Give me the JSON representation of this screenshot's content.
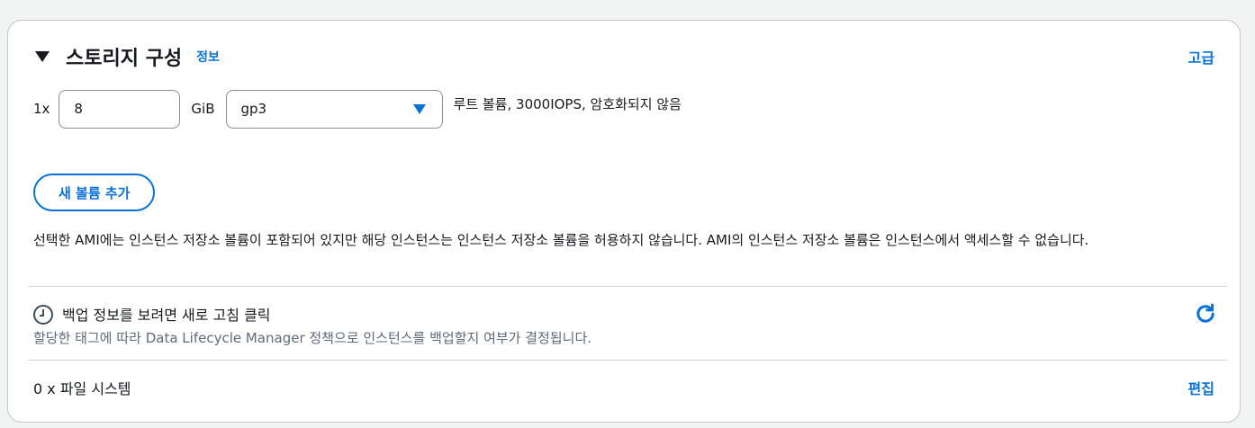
{
  "section": {
    "title": "스토리지 구성",
    "info_link": "정보",
    "advanced_link": "고급"
  },
  "volume": {
    "quantity": "1x",
    "size_value": "8",
    "size_unit": "GiB",
    "type_selected": "gp3",
    "description": "루트 볼륨,  3000IOPS,  암호화되지 않음"
  },
  "add_volume_button": "새 볼륨 추가",
  "note": "선택한 AMI에는 인스턴스 저장소 볼륨이 포함되어 있지만 해당 인스턴스는 인스턴스 저장소 볼륨을 허용하지 않습니다. AMI의 인스턴스 저장소 볼륨은 인스턴스에서 액세스할 수 없습니다.",
  "backup": {
    "title": "백업 정보를 보려면 새로 고침 클릭",
    "subtitle": "할당한 태그에 따라 Data Lifecycle Manager 정책으로 인스턴스를 백업할지 여부가 결정됩니다."
  },
  "file_systems": {
    "label": "0 x 파일 시스템",
    "edit_link": "편집"
  },
  "colors": {
    "accent": "#0972d3",
    "text": "#16191f",
    "muted": "#5f6b7a",
    "border": "#8c8c94"
  },
  "icons": {
    "collapse": "caret-down-icon",
    "select": "select-caret-icon",
    "clock": "clock-icon",
    "refresh": "refresh-icon"
  }
}
